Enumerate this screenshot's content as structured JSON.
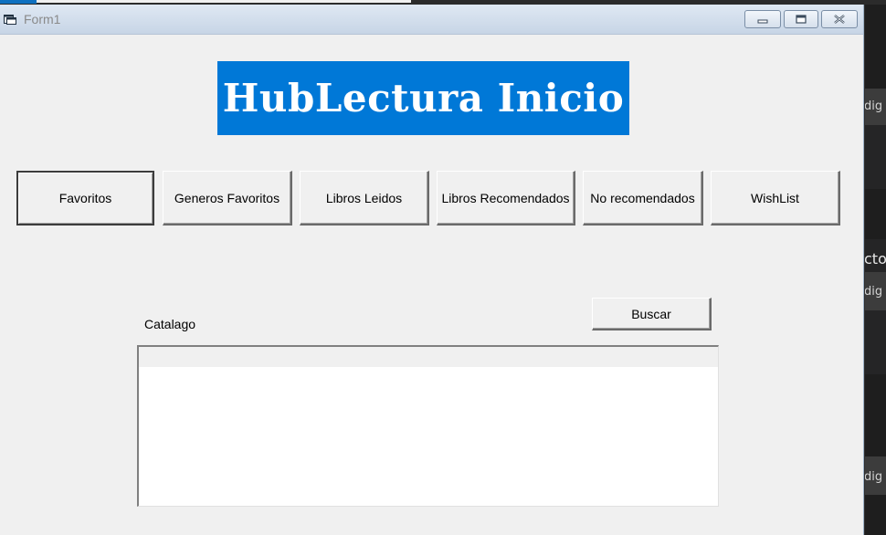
{
  "window": {
    "title": "Form1",
    "controls": {
      "minimize_icon": "minimize-icon",
      "maximize_icon": "restore-icon",
      "close_icon": "close-icon"
    }
  },
  "banner": {
    "text": "HubLectura Inicio",
    "color": "#0078d7"
  },
  "nav": {
    "buttons": [
      {
        "label": "Favoritos"
      },
      {
        "label": "Generos Favoritos"
      },
      {
        "label": "Libros Leidos"
      },
      {
        "label": "Libros Recomendados"
      },
      {
        "label": "No recomendados"
      },
      {
        "label": "WishList"
      }
    ]
  },
  "catalog": {
    "label": "Catalago",
    "search_label": "Buscar"
  },
  "background_editor": {
    "fragments": [
      "dig",
      "cto",
      "dig",
      "dig"
    ]
  }
}
